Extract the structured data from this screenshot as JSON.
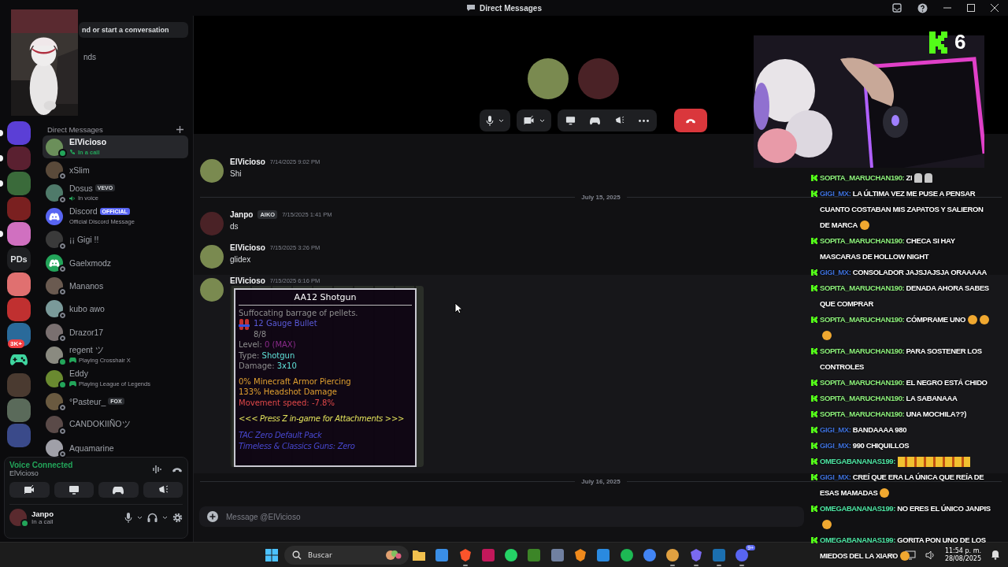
{
  "window": {
    "title": "Direct Messages"
  },
  "server_rail": {
    "servers": [
      {
        "kind": "picture",
        "unread": true
      },
      {
        "kind": "picture",
        "unread": true
      },
      {
        "kind": "picture",
        "unread": true
      },
      {
        "kind": "picture",
        "unread": false
      },
      {
        "kind": "picture",
        "unread": true
      },
      {
        "kind": "text",
        "label": "PDs",
        "unread": false
      },
      {
        "kind": "picture",
        "unread": false
      },
      {
        "kind": "picture",
        "unread": false
      },
      {
        "kind": "picture",
        "unread": false,
        "badge": "3K+"
      },
      {
        "kind": "gamepad",
        "unread": false
      },
      {
        "kind": "picture",
        "unread": false
      },
      {
        "kind": "picture",
        "unread": false
      },
      {
        "kind": "picture",
        "unread": false
      }
    ]
  },
  "dm_sidebar": {
    "search": {
      "placeholder": "nd or start a conversation"
    },
    "nav": [
      {
        "label": "nds"
      }
    ],
    "section_title": "Direct Messages",
    "items": [
      {
        "kind": "user",
        "name": "ElVicioso",
        "status": {
          "text": "In a call",
          "kind": "call"
        },
        "online": true,
        "selected": true
      },
      {
        "kind": "user",
        "name": "xSlim",
        "online": false,
        "selected": false
      },
      {
        "kind": "user",
        "name": "Dosus",
        "badge": {
          "text": "VEVO",
          "kind": "tag"
        },
        "status": {
          "text": "In voice",
          "kind": "voice"
        },
        "online": false,
        "selected": false
      },
      {
        "kind": "official",
        "name": "Discord",
        "badge": {
          "text": "OFFICIAL",
          "kind": "official"
        },
        "status": {
          "text": "Official Discord Message",
          "kind": "plain"
        },
        "selected": false
      },
      {
        "kind": "user",
        "name": "¡¡ Gigi !!",
        "online": false,
        "selected": false
      },
      {
        "kind": "default",
        "name": "Gaelxmodz",
        "online": false,
        "selected": false
      },
      {
        "kind": "user",
        "name": "Mananos",
        "online": false,
        "selected": false
      },
      {
        "kind": "user",
        "name": "kubo awo",
        "online": false,
        "selected": false
      },
      {
        "kind": "user",
        "name": "Drazor17",
        "online": false,
        "selected": false
      },
      {
        "kind": "user",
        "name": "regent ツ",
        "status": {
          "text": "Playing Crosshair X",
          "kind": "game"
        },
        "online": true,
        "selected": false
      },
      {
        "kind": "user",
        "name": "Eddy",
        "status": {
          "text": "Playing League of Legends",
          "kind": "game"
        },
        "online": true,
        "selected": false
      },
      {
        "kind": "user",
        "name": "°Pasteur_",
        "badge": {
          "text": "FOX",
          "kind": "tag"
        },
        "online": false,
        "selected": false
      },
      {
        "kind": "user",
        "name": "CANDOKIIÑOツ",
        "online": false,
        "selected": false
      },
      {
        "kind": "user",
        "name": "Aquamarine",
        "online": false,
        "selected": false
      }
    ]
  },
  "voice_panel": {
    "title": "Voice Connected",
    "channel": "ElVicioso"
  },
  "user_panel": {
    "name": "Janpo",
    "status": "In a call"
  },
  "messages": [
    {
      "kind": "message",
      "author": "ElVicioso",
      "time": "7/14/2025 9:02 PM",
      "text": "Shi"
    },
    {
      "kind": "divider",
      "label": "July 15, 2025"
    },
    {
      "kind": "message",
      "author": "Janpo",
      "tag": "AIKO",
      "time": "7/15/2025 1:41 PM",
      "text": "ds"
    },
    {
      "kind": "message",
      "author": "ElVicioso",
      "time": "7/15/2025 3:26 PM",
      "text": "glidex"
    },
    {
      "kind": "message",
      "author": "ElVicioso",
      "time": "7/15/2025 6:16 PM",
      "attachment": {
        "title": "AA12 Shotgun",
        "lines": [
          {
            "kind": "text",
            "parts": [
              {
                "text": "Suffocating barrage of pellets.",
                "color": "#8e8e8e"
              }
            ]
          },
          {
            "kind": "ammo",
            "parts": [
              {
                "text": "12 Gauge Bullet",
                "color": "#5a5ad8"
              }
            ],
            "count": "8/8"
          },
          {
            "kind": "text",
            "parts": [
              {
                "text": "Level: ",
                "color": "#8e8e8e"
              },
              {
                "text": "0 (MAX)",
                "color": "#8a2a8a"
              }
            ]
          },
          {
            "kind": "text",
            "parts": [
              {
                "text": "Type: ",
                "color": "#8e8e8e"
              },
              {
                "text": "Shotgun",
                "color": "#5fe0d8"
              }
            ]
          },
          {
            "kind": "text",
            "parts": [
              {
                "text": "Damage: ",
                "color": "#8e8e8e"
              },
              {
                "text": "3x10",
                "color": "#5fe0d8"
              }
            ]
          },
          {
            "kind": "gap"
          },
          {
            "kind": "text",
            "parts": [
              {
                "text": "0% Minecraft Armor Piercing",
                "color": "#e0a030"
              }
            ]
          },
          {
            "kind": "text",
            "parts": [
              {
                "text": "133% Headshot Damage",
                "color": "#e0a030"
              }
            ]
          },
          {
            "kind": "text",
            "parts": [
              {
                "text": "Movement speed: -7.8%",
                "color": "#e04848"
              }
            ]
          },
          {
            "kind": "gap"
          },
          {
            "kind": "italic",
            "parts": [
              {
                "text": "<<< Press Z in-game for Attachments >>>",
                "color": "#e4e45c"
              }
            ]
          },
          {
            "kind": "gap"
          },
          {
            "kind": "italic",
            "parts": [
              {
                "text": "TAC Zero Default Pack",
                "color": "#4848d0"
              }
            ]
          },
          {
            "kind": "italic",
            "parts": [
              {
                "text": "Timeless & Classics Guns: Zero",
                "color": "#4848d0"
              }
            ]
          }
        ]
      }
    },
    {
      "kind": "divider",
      "label": "July 16, 2025"
    }
  ],
  "composer": {
    "placeholder": "Message @ElVicioso"
  },
  "stream_overlay": {
    "counter": "6",
    "chat": [
      {
        "user": "SOPITA_MARUCHAN190:",
        "color": "#8ef27c",
        "text": "ZI",
        "emotes": [
          {
            "kind": "statue"
          },
          {
            "kind": "statue"
          }
        ]
      },
      {
        "user": "GIGI_MX:",
        "color": "#3d6fd8",
        "text": "LA ÚLTIMA VEZ ME PUSE A PENSAR CUANTO COSTABAN MIS ZAPATOS Y SALIERON DE MARCA",
        "emotes": [
          {
            "kind": "face"
          }
        ]
      },
      {
        "user": "SOPITA_MARUCHAN190:",
        "color": "#8ef27c",
        "text": "CHECA SI HAY MASCARAS DE HOLLOW NIGHT"
      },
      {
        "user": "GIGI_MX:",
        "color": "#3d6fd8",
        "text": "CONSOLADOR JAJSJAJSJA ORAAAAA"
      },
      {
        "user": "SOPITA_MARUCHAN190:",
        "color": "#8ef27c",
        "text": "DENADA AHORA SABES QUE COMPRAR"
      },
      {
        "user": "SOPITA_MARUCHAN190:",
        "color": "#8ef27c",
        "text": "CÓMPRAME UNO",
        "emotes": [
          {
            "kind": "face"
          },
          {
            "kind": "face"
          },
          {
            "kind": "face"
          }
        ]
      },
      {
        "user": "SOPITA_MARUCHAN190:",
        "color": "#8ef27c",
        "text": "PARA SOSTENER LOS CONTROLES"
      },
      {
        "user": "SOPITA_MARUCHAN190:",
        "color": "#8ef27c",
        "text": "EL NEGRO ESTÁ CHIDO"
      },
      {
        "user": "SOPITA_MARUCHAN190:",
        "color": "#8ef27c",
        "text": "LA SABANAAA"
      },
      {
        "user": "SOPITA_MARUCHAN190:",
        "color": "#8ef27c",
        "text": "UNA MOCHILA??)"
      },
      {
        "user": "GIGI_MX:",
        "color": "#3d6fd8",
        "text": "BANDAAAA 980"
      },
      {
        "user": "GIGI_MX:",
        "color": "#3d6fd8",
        "text": "990 CHIQUILLOS"
      },
      {
        "user": "OMEGABANANAS199:",
        "color": "#4ee6a4",
        "emotes": [
          {
            "kind": "strip"
          }
        ]
      },
      {
        "user": "GIGI_MX:",
        "color": "#3d6fd8",
        "text": "CREÍ QUE ERA LA ÚNICA QUE REÍA DE ESAS MAMADAS",
        "emotes": [
          {
            "kind": "face"
          }
        ]
      },
      {
        "user": "OMEGABANANAS199:",
        "color": "#4ee6a4",
        "text": "NO ERES EL ÚNICO JANPIS",
        "emotes": [
          {
            "kind": "face"
          }
        ]
      },
      {
        "user": "OMEGABANANAS199:",
        "color": "#4ee6a4",
        "text": "GORITA PON UNO DE LOS MIEDOS DEL LA XIARO",
        "emotes": [
          {
            "kind": "face"
          }
        ]
      }
    ]
  },
  "taskbar": {
    "search_placeholder": "Buscar",
    "apps": [
      {
        "kind": "folder",
        "running": false
      },
      {
        "kind": "store",
        "running": false
      },
      {
        "kind": "shield",
        "running": true
      },
      {
        "kind": "square",
        "running": false
      },
      {
        "kind": "chat",
        "running": false
      },
      {
        "kind": "block",
        "running": false
      },
      {
        "kind": "game",
        "running": false
      },
      {
        "kind": "fruit",
        "running": false
      },
      {
        "kind": "code",
        "running": false
      },
      {
        "kind": "music",
        "running": false
      },
      {
        "kind": "browser",
        "running": false
      },
      {
        "kind": "joystick",
        "running": true
      },
      {
        "kind": "diamond",
        "running": true
      },
      {
        "kind": "steam",
        "running": true
      },
      {
        "kind": "discord",
        "running": true,
        "badge": "9+"
      }
    ],
    "time": "11:54 p. m.",
    "date": "28/08/2025"
  }
}
